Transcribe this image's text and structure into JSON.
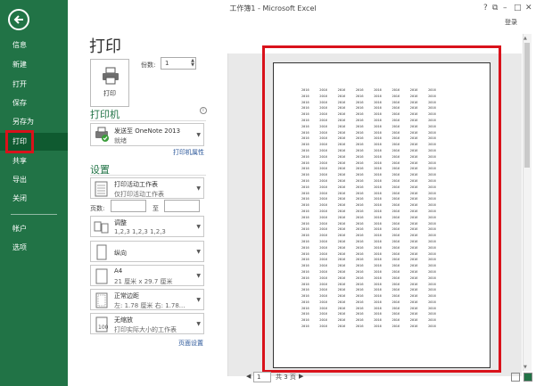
{
  "window": {
    "title": "工作簿1 - Microsoft Excel",
    "help": "?",
    "restore": "⧉",
    "minimize": "–",
    "maximize": "□",
    "close": "✕",
    "login": "登录"
  },
  "nav": {
    "items": [
      "信息",
      "新建",
      "打开",
      "保存",
      "另存为",
      "打印",
      "共享",
      "导出",
      "关闭",
      "帐户",
      "选项"
    ],
    "active": "打印"
  },
  "print": {
    "heading": "打印",
    "button_label": "打印",
    "copies_label": "份数:",
    "copies_value": "1"
  },
  "printer": {
    "section": "打印机",
    "name": "发送至 OneNote 2013",
    "status": "就绪",
    "properties_link": "打印机属性",
    "info_icon": "i"
  },
  "settings": {
    "section": "设置",
    "scope": {
      "title": "打印活动工作表",
      "desc": "仅打印活动工作表"
    },
    "pages_label": "页数:",
    "to_label": "至",
    "collate": {
      "title": "调整",
      "desc": "1,2,3    1,2,3    1,2,3"
    },
    "orientation": {
      "title": "纵向"
    },
    "paper": {
      "title": "A4",
      "desc": "21 厘米 x 29.7 厘米"
    },
    "margins": {
      "title": "正常边距",
      "desc": "左: 1.78 厘米    右: 1.78..."
    },
    "scaling": {
      "title": "无缩放",
      "desc": "打印实际大小的工作表"
    },
    "page_setup_link": "页面设置"
  },
  "preview": {
    "cell_text": "2016",
    "rows": 40,
    "cols": 8,
    "current_page": "1",
    "total_pages": "共 3 页",
    "prev": "◀",
    "next": "▶"
  },
  "colors": {
    "nav_green": "#217346",
    "highlight_red": "#d9121b"
  }
}
